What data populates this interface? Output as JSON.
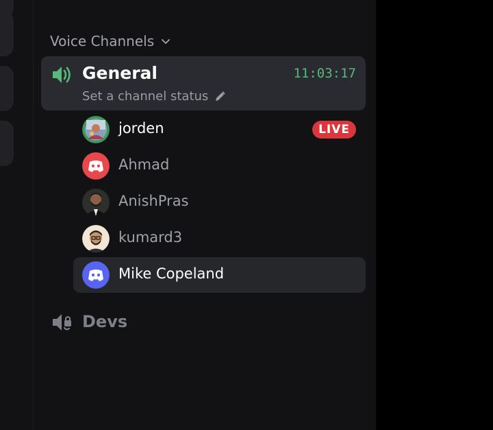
{
  "voice_category": {
    "label": "Voice Channels"
  },
  "general": {
    "name": "General",
    "timer": "11:03:17",
    "status_prompt": "Set a channel status"
  },
  "members": [
    {
      "name": "jorden",
      "badge": "LIVE"
    },
    {
      "name": "Ahmad"
    },
    {
      "name": "AnishPras"
    },
    {
      "name": "kumard3"
    },
    {
      "name": "Mike Copeland"
    }
  ],
  "devs": {
    "name": "Devs"
  },
  "colors": {
    "accent_green": "#57b97a",
    "live_red": "#da373c",
    "discord_blurple": "#5865f2",
    "discord_red": "#e8474b"
  }
}
